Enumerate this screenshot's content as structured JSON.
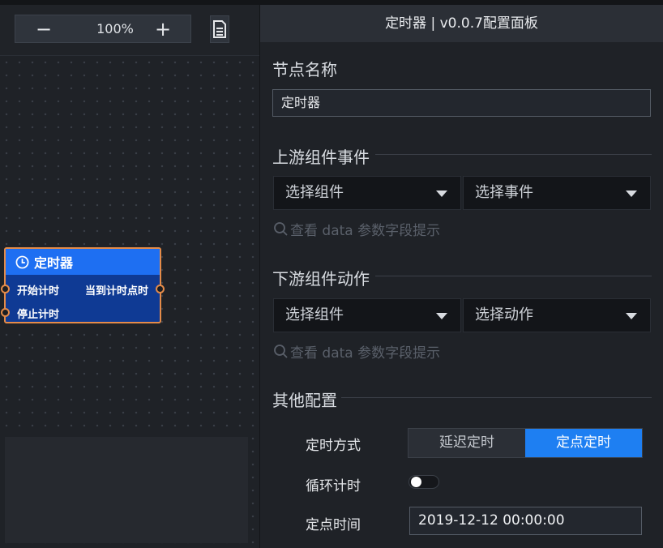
{
  "toolbar": {
    "zoom_out": "−",
    "zoom_value": "100%",
    "zoom_in": "+"
  },
  "node": {
    "title": "定时器",
    "input_start": "开始计时",
    "input_stop": "停止计时",
    "output_event": "当到计时点时"
  },
  "panel": {
    "header": "定时器 | v0.0.7配置面板",
    "node_name_title": "节点名称",
    "node_name_value": "定时器",
    "upstream_title": "上游组件事件",
    "upstream_component": "选择组件",
    "upstream_event": "选择事件",
    "upstream_hint": "查看 data 参数字段提示",
    "downstream_title": "下游组件动作",
    "downstream_component": "选择组件",
    "downstream_action": "选择动作",
    "downstream_hint": "查看 data 参数字段提示",
    "other_title": "其他配置",
    "timing_mode_label": "定时方式",
    "timing_mode_options": [
      "延迟定时",
      "定点定时"
    ],
    "timing_mode_selected": "定点定时",
    "loop_label": "循环计时",
    "loop_on": false,
    "fixed_time_label": "定点时间",
    "fixed_time_value": "2019-12-12 00:00:00"
  },
  "colors": {
    "accent": "#1e7ff2",
    "node_border": "#e48b49",
    "node_header": "#1e6ff2"
  }
}
